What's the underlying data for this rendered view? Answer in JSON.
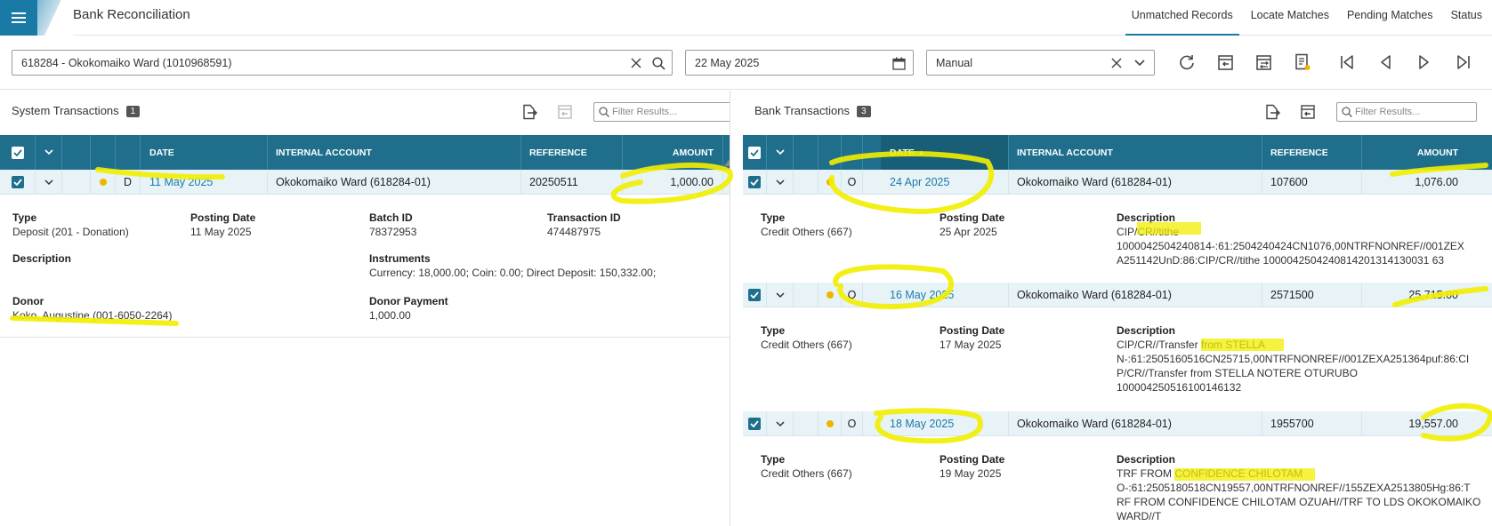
{
  "header": {
    "title": "Bank Reconciliation",
    "tabs": [
      {
        "label": "Unmatched Records",
        "active": true
      },
      {
        "label": "Locate Matches",
        "active": false
      },
      {
        "label": "Pending Matches",
        "active": false
      },
      {
        "label": "Status",
        "active": false
      }
    ]
  },
  "filters": {
    "account": "618284 - Okokomaiko Ward (1010968591)",
    "date": "22 May 2025",
    "mode": "Manual"
  },
  "system": {
    "title": "System Transactions",
    "count": "1",
    "filter_placeholder": "Filter Results...",
    "columns": {
      "date": "DATE",
      "account": "INTERNAL ACCOUNT",
      "reference": "REFERENCE",
      "amount": "AMOUNT"
    },
    "row": {
      "type_code": "D",
      "date": "11 May 2025",
      "account": "Okokomaiko Ward (618284-01)",
      "reference": "20250511",
      "amount": "1,000.00"
    },
    "detail": {
      "type_label": "Type",
      "type_value": "Deposit (201 - Donation)",
      "posting_label": "Posting Date",
      "posting_value": "11 May 2025",
      "batch_label": "Batch ID",
      "batch_value": "78372953",
      "txn_label": "Transaction ID",
      "txn_value": "474487975",
      "desc_label": "Description",
      "instr_label": "Instruments",
      "instr_value": "Currency: 18,000.00; Coin: 0.00; Direct Deposit: 150,332.00;",
      "donor_label": "Donor",
      "donor_value": "Koko, Augustine (001-6050-2264)",
      "donor_pay_label": "Donor Payment",
      "donor_pay_value": "1,000.00"
    }
  },
  "bank": {
    "title": "Bank Transactions",
    "count": "3",
    "filter_placeholder": "Filter Results...",
    "columns": {
      "date": "DATE",
      "sort": "▲",
      "account": "INTERNAL ACCOUNT",
      "reference": "REFERENCE",
      "amount": "AMOUNT"
    },
    "rows": [
      {
        "type_code": "O",
        "date": "24 Apr 2025",
        "account": "Okokomaiko Ward (618284-01)",
        "reference": "107600",
        "amount": "1,076.00",
        "type_label": "Type",
        "type_value": "Credit Others (667)",
        "posting_label": "Posting Date",
        "posting_value": "25 Apr 2025",
        "desc_label": "Description",
        "desc_lines": [
          "CIP/CR//tithe",
          "1000042504240814-:61:2504240424CN1076,00NTRFNONREF//001ZEX",
          "A251142UnD:86:CIP/CR//tithe 1000042504240814201314130031 63"
        ]
      },
      {
        "type_code": "O",
        "date": "16 May 2025",
        "account": "Okokomaiko Ward (618284-01)",
        "reference": "2571500",
        "amount": "25,715.00",
        "type_label": "Type",
        "type_value": "Credit Others (667)",
        "posting_label": "Posting Date",
        "posting_value": "17 May 2025",
        "desc_label": "Description",
        "desc_lines": [
          "CIP/CR//Transfer from STELLA",
          "N-:61:2505160516CN25715,00NTRFNONREF//001ZEXA251364puf:86:CI",
          "P/CR//Transfer from STELLA NOTERE OTURUBO",
          "100004250516100146132"
        ]
      },
      {
        "type_code": "O",
        "date": "18 May 2025",
        "account": "Okokomaiko Ward (618284-01)",
        "reference": "1955700",
        "amount": "19,557.00",
        "type_label": "Type",
        "type_value": "Credit Others (667)",
        "posting_label": "Posting Date",
        "posting_value": "19 May 2025",
        "desc_label": "Description",
        "desc_lines": [
          "TRF FROM CONFIDENCE CHILOTAM",
          "O-:61:2505180518CN19557,00NTRFNONREF//155ZEXA2513805Hg:86:T",
          "RF FROM CONFIDENCE CHILOTAM OZUAH//TRF TO LDS OKOKOMAIKO",
          "WARD//T"
        ]
      }
    ]
  },
  "colors": {
    "accent": "#1a7aa6",
    "header": "#1f6f8c",
    "row": "#e8f3f8",
    "status_dot": "#f0b400",
    "highlight": "#f2ee00"
  }
}
